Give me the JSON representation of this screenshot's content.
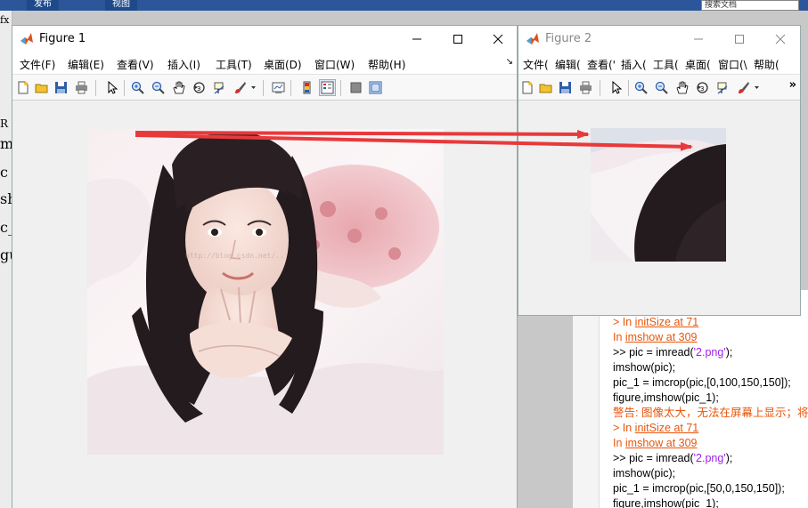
{
  "desktop": {
    "ribbon_tabs": [
      "发布",
      "视图"
    ],
    "search_placeholder": "搜索文档",
    "left_glyphs": [
      "fx",
      "R",
      "m",
      "c",
      "sh",
      "c_",
      "gu"
    ]
  },
  "figure1": {
    "title": "Figure 1",
    "menu": [
      "文件(F)",
      "编辑(E)",
      "查看(V)",
      "插入(I)",
      "工具(T)",
      "桌面(D)",
      "窗口(W)",
      "帮助(H)"
    ],
    "more_glyph": "↘"
  },
  "figure2": {
    "title": "Figure 2",
    "menu": [
      "文件(",
      "编辑(",
      "查看('",
      "插入(",
      "工具(",
      "桌面(",
      "窗口(\\",
      "帮助("
    ],
    "overflow_glyph": "»"
  },
  "command_window": {
    "lines": [
      {
        "kind": "warn",
        "parts": [
          {
            "t": "> In "
          },
          {
            "t": "initSize at 71",
            "u": true
          }
        ]
      },
      {
        "kind": "warn",
        "parts": [
          {
            "t": "  In "
          },
          {
            "t": "imshow at 309",
            "u": true
          }
        ]
      },
      {
        "kind": "code",
        "parts": [
          {
            "t": ">> pic = imread("
          },
          {
            "t": "'2.png'",
            "s": true
          },
          {
            "t": ");"
          }
        ]
      },
      {
        "kind": "code",
        "parts": [
          {
            "t": "imshow(pic);"
          }
        ]
      },
      {
        "kind": "code",
        "parts": [
          {
            "t": "pic_1 = imcrop(pic,[0,100,150,150]);"
          }
        ]
      },
      {
        "kind": "code",
        "parts": [
          {
            "t": "figure,imshow(pic_1);"
          }
        ]
      },
      {
        "kind": "warn",
        "parts": [
          {
            "t": "警告: 图像太大，无法在屏幕上显示；将以"
          }
        ]
      },
      {
        "kind": "warn",
        "parts": [
          {
            "t": "> In "
          },
          {
            "t": "initSize at 71",
            "u": true
          }
        ]
      },
      {
        "kind": "warn",
        "parts": [
          {
            "t": "  In "
          },
          {
            "t": "imshow at 309",
            "u": true
          }
        ]
      },
      {
        "kind": "code",
        "parts": [
          {
            "t": ">> pic = imread("
          },
          {
            "t": "'2.png'",
            "s": true
          },
          {
            "t": ");"
          }
        ]
      },
      {
        "kind": "code",
        "parts": [
          {
            "t": "imshow(pic);"
          }
        ]
      },
      {
        "kind": "code",
        "parts": [
          {
            "t": "pic_1 = imcrop(pic,[50,0,150,150]);"
          }
        ]
      },
      {
        "kind": "code",
        "parts": [
          {
            "t": "figure,imshow(pic_1);"
          }
        ]
      }
    ]
  },
  "colors": {
    "arrow": "#e8393b",
    "warn": "#e8560b",
    "string": "#a020f0",
    "titlebar_bg": "#ffffff",
    "figure_bg": "#f0f0f0"
  }
}
